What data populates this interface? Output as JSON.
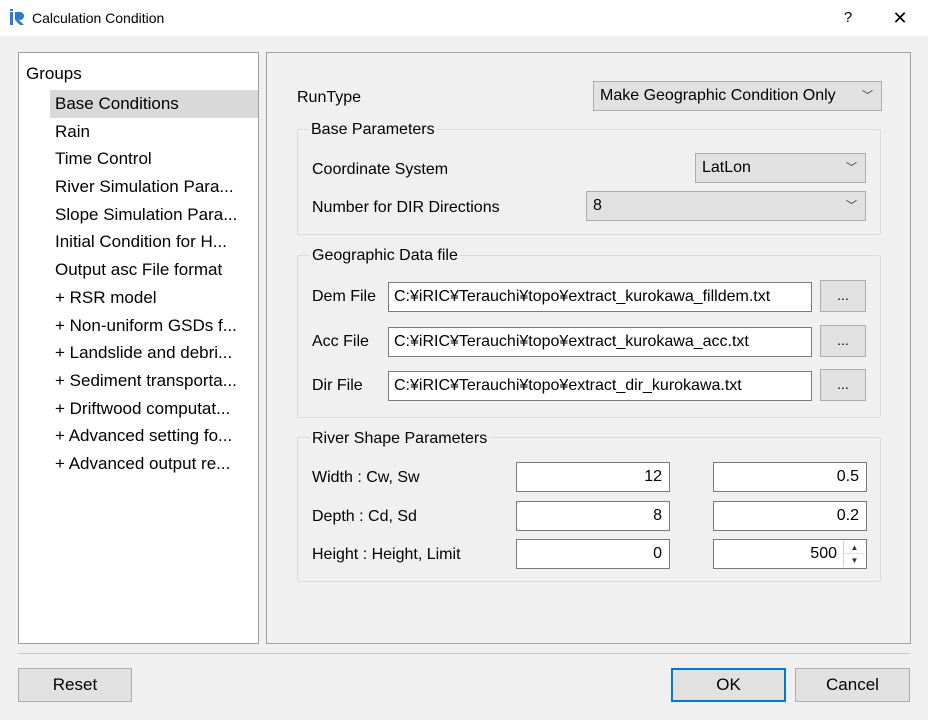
{
  "window": {
    "title": "Calculation Condition",
    "help_label": "?",
    "close_label": "✕"
  },
  "groups": {
    "header": "Groups",
    "items": [
      {
        "label": "Base Conditions"
      },
      {
        "label": "Rain"
      },
      {
        "label": "Time Control"
      },
      {
        "label": "River Simulation Para..."
      },
      {
        "label": "Slope Simulation Para..."
      },
      {
        "label": "Initial Condition for H..."
      },
      {
        "label": "Output asc File format"
      },
      {
        "label": "+ RSR model"
      },
      {
        "label": "+ Non-uniform GSDs f..."
      },
      {
        "label": "+ Landslide and debri..."
      },
      {
        "label": "+ Sediment transporta..."
      },
      {
        "label": "+ Driftwood computat..."
      },
      {
        "label": "+ Advanced setting fo..."
      },
      {
        "label": "+ Advanced output re..."
      }
    ],
    "selected_index": 0
  },
  "runtype": {
    "label": "RunType",
    "value": "Make Geographic Condition Only"
  },
  "base_parameters": {
    "title": "Base Parameters",
    "coordinate_system": {
      "label": "Coordinate System",
      "value": "LatLon"
    },
    "dir_directions": {
      "label": "Number for DIR Directions",
      "value": "8"
    }
  },
  "geographic_data": {
    "title": "Geographic Data file",
    "dem": {
      "label": "Dem File",
      "value": "C:¥iRIC¥Terauchi¥topo¥extract_kurokawa_filldem.txt",
      "browse": "..."
    },
    "acc": {
      "label": "Acc File",
      "value": "C:¥iRIC¥Terauchi¥topo¥extract_kurokawa_acc.txt",
      "browse": "..."
    },
    "dir": {
      "label": "Dir File",
      "value": "C:¥iRIC¥Terauchi¥topo¥extract_dir_kurokawa.txt",
      "browse": "..."
    }
  },
  "river_shape": {
    "title": "River Shape Parameters",
    "width": {
      "label": "Width : Cw, Sw",
      "v1": "12",
      "v2": "0.5"
    },
    "depth": {
      "label": "Depth : Cd, Sd",
      "v1": "8",
      "v2": "0.2"
    },
    "height": {
      "label": "Height : Height, Limit",
      "v1": "0",
      "v2": "500"
    }
  },
  "footer": {
    "reset": "Reset",
    "ok": "OK",
    "cancel": "Cancel"
  },
  "colors": {
    "accent": "#0078d7",
    "selection": "#d9d9d9",
    "app_icon": "#2a7bd1"
  }
}
